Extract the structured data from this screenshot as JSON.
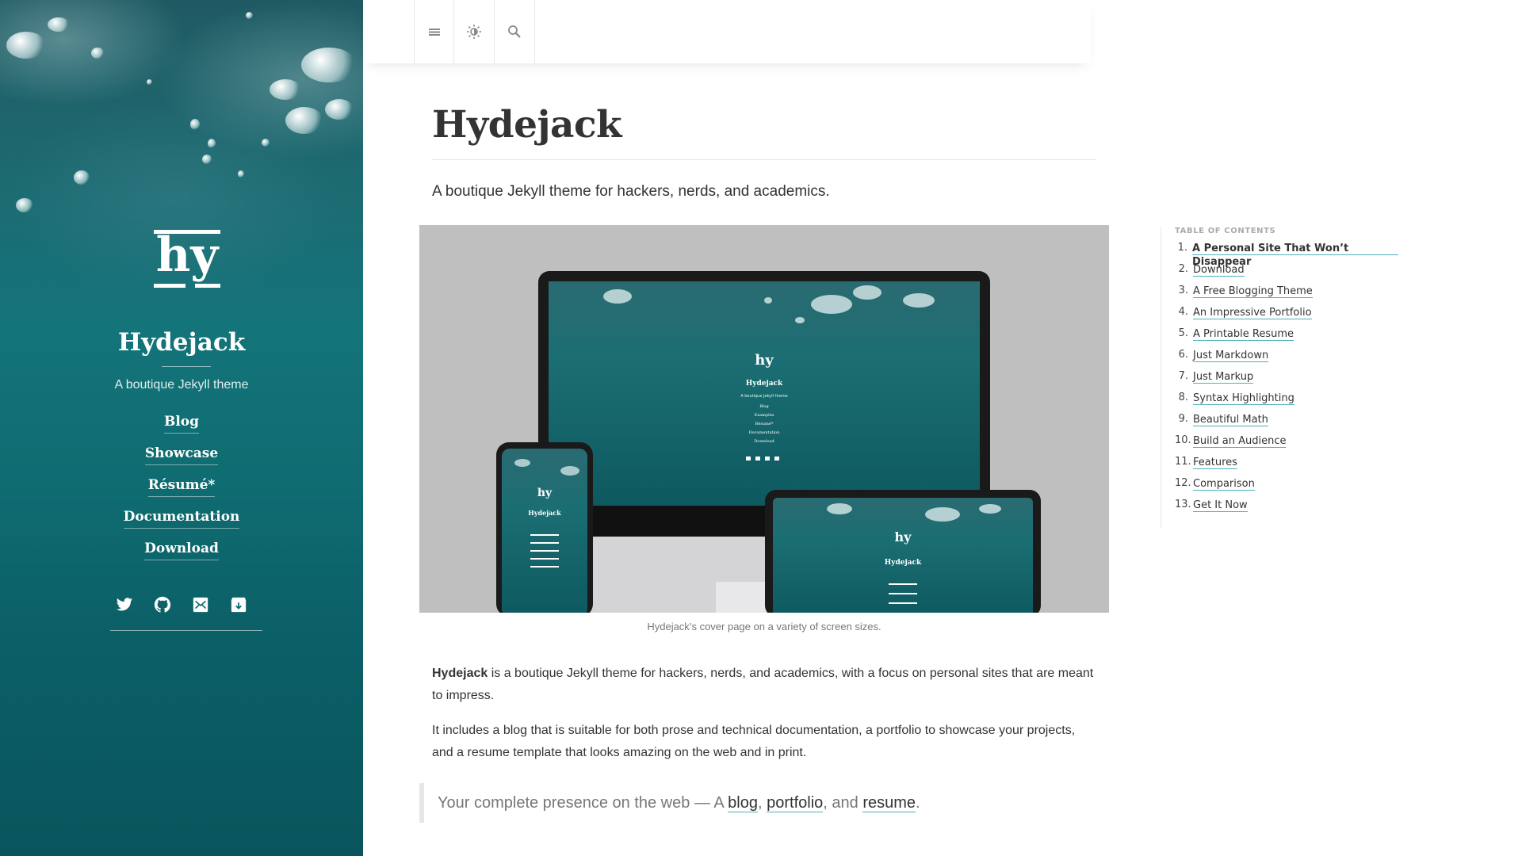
{
  "sidebar": {
    "logo_text": "hy",
    "title": "Hydejack",
    "tagline": "A boutique Jekyll theme",
    "nav": [
      {
        "label": "Blog"
      },
      {
        "label": "Showcase"
      },
      {
        "label": "Résumé*"
      },
      {
        "label": "Documentation"
      },
      {
        "label": "Download"
      }
    ],
    "socials": [
      {
        "icon": "twitter-icon"
      },
      {
        "icon": "github-icon"
      },
      {
        "icon": "email-icon"
      },
      {
        "icon": "rss-icon"
      }
    ]
  },
  "topbar": {
    "buttons": [
      {
        "icon": "menu-icon"
      },
      {
        "icon": "theme-toggle-icon"
      },
      {
        "icon": "search-icon"
      }
    ]
  },
  "main": {
    "title": "Hydejack",
    "lead": "A boutique Jekyll theme for hackers, nerds, and academics.",
    "figure": {
      "caption": "Hydejack’s cover page on a variety of screen sizes.",
      "device_screen": {
        "title": "Hydejack",
        "tagline": "A boutique Jekyll theme",
        "nav": [
          "Blog",
          "Examples",
          "Résumé*",
          "Documentation",
          "Download"
        ]
      }
    },
    "para1_strong": "Hydejack",
    "para1_rest": " is a boutique Jekyll theme for hackers, nerds, and academics, with a focus on personal sites that are meant to impress.",
    "para2": "It includes a blog that is suitable for both prose and technical documentation, a portfolio to showcase your projects, and a resume template that looks amazing on the web and in print.",
    "quote": {
      "prefix": "Your complete presence on the web — A ",
      "link1": "blog",
      "sep1": ", ",
      "link2": "portfolio",
      "sep2": ", and ",
      "link3": "resume",
      "suffix": "."
    }
  },
  "toc": {
    "heading": "Table of Contents",
    "items": [
      {
        "num": "1.",
        "label": "A Personal Site That Won’t Disappear"
      },
      {
        "num": "2.",
        "label": "Download"
      },
      {
        "num": "3.",
        "label": "A Free Blogging Theme"
      },
      {
        "num": "4.",
        "label": "An Impressive Portfolio"
      },
      {
        "num": "5.",
        "label": "A Printable Resume"
      },
      {
        "num": "6.",
        "label": "Just Markdown"
      },
      {
        "num": "7.",
        "label": "Just Markup"
      },
      {
        "num": "8.",
        "label": "Syntax Highlighting"
      },
      {
        "num": "9.",
        "label": "Beautiful Math"
      },
      {
        "num": "10.",
        "label": "Build an Audience"
      },
      {
        "num": "11.",
        "label": "Features"
      },
      {
        "num": "12.",
        "label": "Comparison"
      },
      {
        "num": "13.",
        "label": "Get It Now"
      }
    ]
  },
  "colors": {
    "sidebar_bg": "#0f6d72",
    "accent_underline": "#4fb1ba",
    "text": "#333333",
    "figure_bg": "#bfbfbf"
  }
}
